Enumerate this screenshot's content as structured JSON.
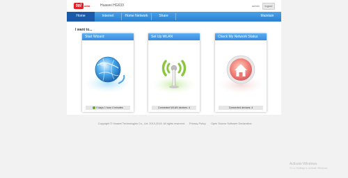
{
  "header": {
    "logo": "tel",
    "logo_sub": "data",
    "model": "Huawei HG633",
    "user": "admin",
    "logout": "logout"
  },
  "nav": {
    "items": [
      {
        "label": "Home",
        "active": true
      },
      {
        "label": "Internet"
      },
      {
        "label": "Home Network"
      },
      {
        "label": "Share"
      }
    ],
    "maintain": "Maintain"
  },
  "main": {
    "heading": "I want to...",
    "cards": [
      {
        "title": "Start Wizard",
        "status": "0 days 1 hour 4 minutes",
        "icon": "globe-icon",
        "color": "#4aa3e8"
      },
      {
        "title": "Set Up WLAN",
        "status": "Connected WLAN devices: 4",
        "icon": "wifi-antenna-icon",
        "color": "#7cc243"
      },
      {
        "title": "Check My Network Status",
        "status": "Connected devices: 4",
        "icon": "home-icon",
        "color": "#ef7a7c"
      }
    ]
  },
  "footer": {
    "copyright": "Copyright © Huawei Technologies Co., Ltd. 2013-2016. All rights reserved.",
    "privacy": "Privacy Policy",
    "open_source": "Open Source Software Declaration"
  },
  "os_watermark": {
    "line1": "Activate Windows",
    "line2": "Go to Settings to activate Windows."
  }
}
